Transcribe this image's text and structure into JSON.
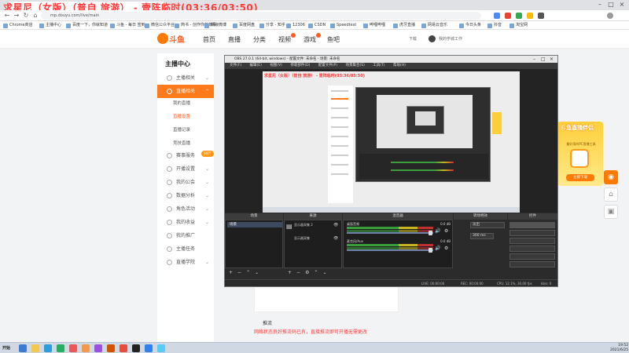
{
  "overlay": {
    "stream_title": "求星尼（女版）（普自 旅游） - 壹阵临时(03:36/03:50)"
  },
  "browser": {
    "url": "mp.douyu.com/live/main",
    "bookmarks": [
      "Chrome商店",
      "主播中心",
      "百度一下，你就知道",
      "斗鱼 - 每日 签到",
      "微信公众平台",
      "简书 - 创作你的故事",
      "新浪微博",
      "百度网盘",
      "分享 - 知乎",
      "12306",
      "CSDN",
      "Speedtest",
      "哔哩哔哩",
      "虎牙直播",
      "网易云音乐",
      "今日头条",
      "抖音",
      "淘宝网"
    ],
    "ext_colors": [
      "#4c8bf5",
      "#ea4335",
      "#34a853",
      "#fbbc05",
      "#555555"
    ]
  },
  "header": {
    "logo_text": "斗鱼",
    "nav": [
      "首页",
      "直播",
      "分类",
      "视频",
      "游戏",
      "鱼吧"
    ],
    "right": [
      "下载",
      "我的学城工作"
    ]
  },
  "sidebar": {
    "title": "主播中心",
    "items": [
      {
        "label": "主播相关",
        "active": false
      },
      {
        "label": "直播相关",
        "active": true
      },
      {
        "label": "赛事服务",
        "active": false
      },
      {
        "label": "开播设置",
        "active": false
      },
      {
        "label": "我的公会",
        "active": false
      },
      {
        "label": "数据分析",
        "active": false
      },
      {
        "label": "角色活动",
        "active": false
      },
      {
        "label": "我的收益",
        "active": false
      },
      {
        "label": "我的推广",
        "active": false
      },
      {
        "label": "主播任务",
        "active": false
      },
      {
        "label": "直播学院",
        "active": false
      }
    ],
    "subs": [
      {
        "label": "我的直播",
        "active": false
      },
      {
        "label": "直播设置",
        "active": true
      },
      {
        "label": "直播记录",
        "active": false
      },
      {
        "label": "竞技直播",
        "active": false
      }
    ],
    "hot": "HOT"
  },
  "main": {
    "label": "推流",
    "note": "网络状态良好推流码已有，直接推流即可开播无需更改"
  },
  "promo": {
    "title": "斗鱼直播伴侣",
    "sub": "最好用的PC直播工具",
    "button": "立即下载"
  },
  "float_buttons": [
    "◉",
    "⌂",
    "▣"
  ],
  "obs": {
    "title": "OBS 27.0.1 (64-bit, windows) - 配置文件: 未命名 - 场景: 未命名",
    "menu": [
      "文件(F)",
      "编辑(E)",
      "视图(V)",
      "停靠部件(D)",
      "配置文件(P)",
      "场景集合(S)",
      "工具(T)",
      "帮助(H)"
    ],
    "docks": [
      "场景",
      "来源",
      "混音器",
      "转场特效",
      "控件"
    ],
    "scene_item": "场景",
    "sources": [
      "显示器采集 2",
      "显示器采集"
    ],
    "mixer": [
      {
        "label": "桌面音频",
        "db": "0.0 dB"
      },
      {
        "label": "麦克风/Aux",
        "db": "0.0 dB"
      }
    ],
    "transition": "淡出",
    "duration": "300 ms",
    "status": {
      "live": "LIVE: 00:00:00",
      "rec": "REC: 00:00:00",
      "cpu": "CPU: 12.1%, 30.00 fps",
      "kbps": "kb/s: 0"
    }
  },
  "taskbar": {
    "start": "开始",
    "apps": [
      "#3a7bd5",
      "#f2c94c",
      "#2d9cdb",
      "#27ae60",
      "#eb5757",
      "#f2994a",
      "#9b51e0",
      "#d35400",
      "#e74c3c",
      "#222222",
      "#2f80ed",
      "#56ccf2"
    ],
    "time": "19:52",
    "date": "2021/6/25"
  }
}
